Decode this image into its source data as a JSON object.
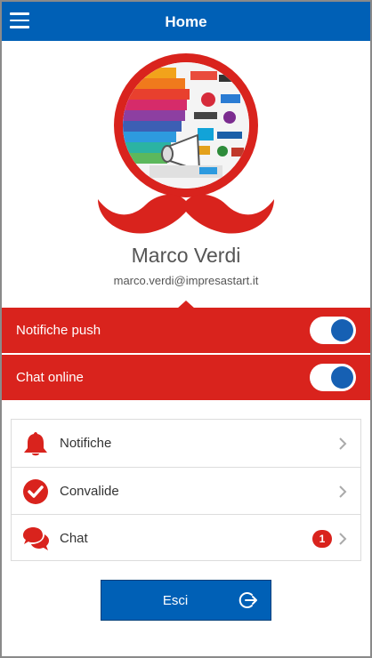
{
  "header": {
    "title": "Home",
    "menu_icon": "hamburger-menu-icon"
  },
  "profile": {
    "name": "Marco Verdi",
    "email": "marco.verdi@impresastart.it",
    "avatar_icon": "profile-collage-image",
    "decoration_icon": "moustache-icon"
  },
  "settings": [
    {
      "label": "Notifiche push",
      "enabled": true
    },
    {
      "label": "Chat online",
      "enabled": true
    }
  ],
  "menu": {
    "items": [
      {
        "label": "Notifiche",
        "icon": "bell-icon"
      },
      {
        "label": "Convalide",
        "icon": "check-circle-icon"
      },
      {
        "label": "Chat",
        "icon": "chat-bubbles-icon",
        "badge": "1"
      }
    ]
  },
  "logout": {
    "label": "Esci",
    "icon": "logout-icon"
  },
  "colors": {
    "primary": "#0060b6",
    "accent": "#d9231d",
    "toggle_knob": "#1660b3"
  }
}
